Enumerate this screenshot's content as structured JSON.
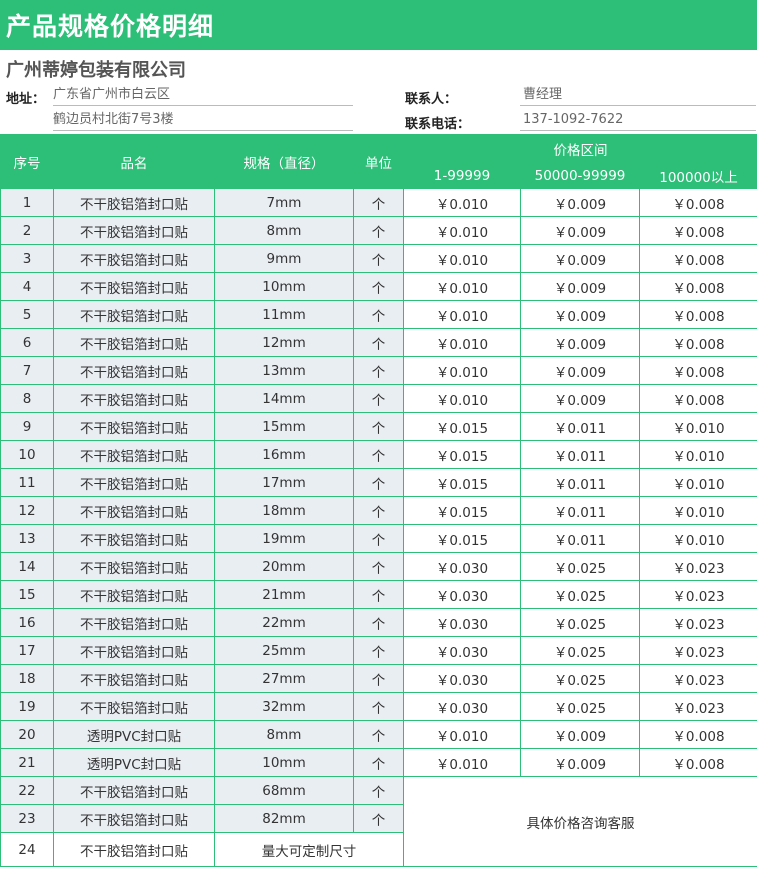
{
  "header": {
    "title": "产品规格价格明细"
  },
  "company": {
    "name": "广州蒂婷包装有限公司"
  },
  "info": {
    "address_label": "地址：",
    "address_line1": "广东省广州市白云区",
    "address_line2": "鹤边员村北街7号3楼",
    "contact_label": "联系人：",
    "contact_value": "曹经理",
    "phone_label": "联系电话：",
    "phone_value": "137-1092-7622"
  },
  "table": {
    "headers": {
      "index": "序号",
      "name": "品名",
      "spec": "规格（直径）",
      "unit": "单位",
      "price_range": "价格区间",
      "tier1": "1-99999",
      "tier2": "50000-99999",
      "tier3": "100000以上"
    },
    "rows": [
      {
        "index": "1",
        "name": "不干胶铝箔封口贴",
        "spec": "7mm",
        "unit": "个",
        "p1": "￥0.010",
        "p2": "￥0.009",
        "p3": "￥0.008"
      },
      {
        "index": "2",
        "name": "不干胶铝箔封口贴",
        "spec": "8mm",
        "unit": "个",
        "p1": "￥0.010",
        "p2": "￥0.009",
        "p3": "￥0.008"
      },
      {
        "index": "3",
        "name": "不干胶铝箔封口贴",
        "spec": "9mm",
        "unit": "个",
        "p1": "￥0.010",
        "p2": "￥0.009",
        "p3": "￥0.008"
      },
      {
        "index": "4",
        "name": "不干胶铝箔封口贴",
        "spec": "10mm",
        "unit": "个",
        "p1": "￥0.010",
        "p2": "￥0.009",
        "p3": "￥0.008"
      },
      {
        "index": "5",
        "name": "不干胶铝箔封口贴",
        "spec": "11mm",
        "unit": "个",
        "p1": "￥0.010",
        "p2": "￥0.009",
        "p3": "￥0.008"
      },
      {
        "index": "6",
        "name": "不干胶铝箔封口贴",
        "spec": "12mm",
        "unit": "个",
        "p1": "￥0.010",
        "p2": "￥0.009",
        "p3": "￥0.008"
      },
      {
        "index": "7",
        "name": "不干胶铝箔封口贴",
        "spec": "13mm",
        "unit": "个",
        "p1": "￥0.010",
        "p2": "￥0.009",
        "p3": "￥0.008"
      },
      {
        "index": "8",
        "name": "不干胶铝箔封口贴",
        "spec": "14mm",
        "unit": "个",
        "p1": "￥0.010",
        "p2": "￥0.009",
        "p3": "￥0.008"
      },
      {
        "index": "9",
        "name": "不干胶铝箔封口贴",
        "spec": "15mm",
        "unit": "个",
        "p1": "￥0.015",
        "p2": "￥0.011",
        "p3": "￥0.010"
      },
      {
        "index": "10",
        "name": "不干胶铝箔封口贴",
        "spec": "16mm",
        "unit": "个",
        "p1": "￥0.015",
        "p2": "￥0.011",
        "p3": "￥0.010"
      },
      {
        "index": "11",
        "name": "不干胶铝箔封口贴",
        "spec": "17mm",
        "unit": "个",
        "p1": "￥0.015",
        "p2": "￥0.011",
        "p3": "￥0.010"
      },
      {
        "index": "12",
        "name": "不干胶铝箔封口贴",
        "spec": "18mm",
        "unit": "个",
        "p1": "￥0.015",
        "p2": "￥0.011",
        "p3": "￥0.010"
      },
      {
        "index": "13",
        "name": "不干胶铝箔封口贴",
        "spec": "19mm",
        "unit": "个",
        "p1": "￥0.015",
        "p2": "￥0.011",
        "p3": "￥0.010"
      },
      {
        "index": "14",
        "name": "不干胶铝箔封口贴",
        "spec": "20mm",
        "unit": "个",
        "p1": "￥0.030",
        "p2": "￥0.025",
        "p3": "￥0.023"
      },
      {
        "index": "15",
        "name": "不干胶铝箔封口贴",
        "spec": "21mm",
        "unit": "个",
        "p1": "￥0.030",
        "p2": "￥0.025",
        "p3": "￥0.023"
      },
      {
        "index": "16",
        "name": "不干胶铝箔封口贴",
        "spec": "22mm",
        "unit": "个",
        "p1": "￥0.030",
        "p2": "￥0.025",
        "p3": "￥0.023"
      },
      {
        "index": "17",
        "name": "不干胶铝箔封口贴",
        "spec": "25mm",
        "unit": "个",
        "p1": "￥0.030",
        "p2": "￥0.025",
        "p3": "￥0.023"
      },
      {
        "index": "18",
        "name": "不干胶铝箔封口贴",
        "spec": "27mm",
        "unit": "个",
        "p1": "￥0.030",
        "p2": "￥0.025",
        "p3": "￥0.023"
      },
      {
        "index": "19",
        "name": "不干胶铝箔封口贴",
        "spec": "32mm",
        "unit": "个",
        "p1": "￥0.030",
        "p2": "￥0.025",
        "p3": "￥0.023"
      },
      {
        "index": "20",
        "name": "透明PVC封口贴",
        "spec": "8mm",
        "unit": "个",
        "p1": "￥0.010",
        "p2": "￥0.009",
        "p3": "￥0.008"
      },
      {
        "index": "21",
        "name": "透明PVC封口贴",
        "spec": "10mm",
        "unit": "个",
        "p1": "￥0.010",
        "p2": "￥0.009",
        "p3": "￥0.008"
      }
    ],
    "extra_rows": [
      {
        "index": "22",
        "name": "不干胶铝箔封口贴",
        "spec": "68mm",
        "unit": "个"
      },
      {
        "index": "23",
        "name": "不干胶铝箔封口贴",
        "spec": "82mm",
        "unit": "个"
      },
      {
        "index": "24",
        "name": "不干胶铝箔封口贴",
        "spec": "量大可定制尺寸"
      }
    ],
    "note": "具体价格咨询客服"
  },
  "colors": {
    "accent": "#2dbe78",
    "row_bg": "#e9eef3"
  }
}
